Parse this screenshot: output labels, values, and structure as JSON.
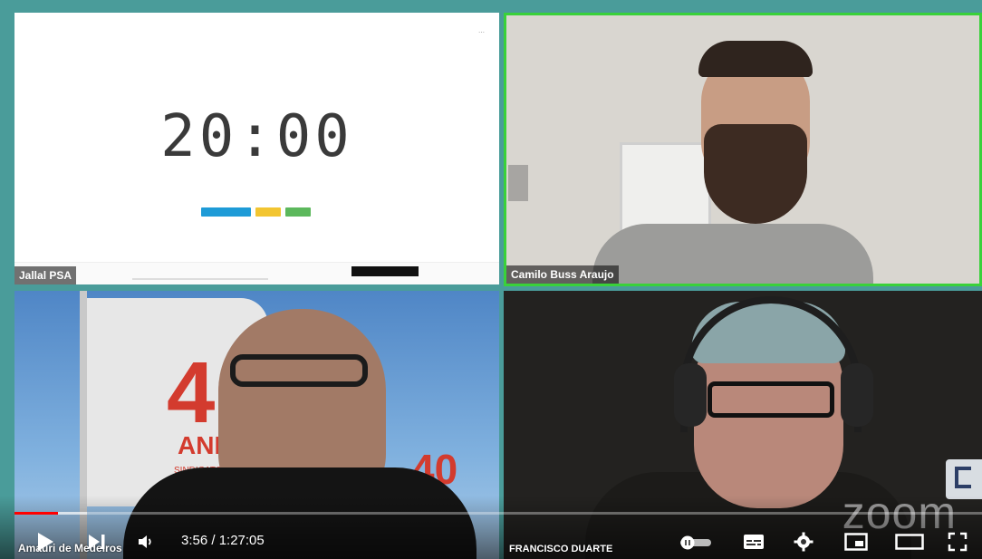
{
  "participants": [
    {
      "name": "Jallal PSA"
    },
    {
      "name": "Camilo Buss Araujo"
    },
    {
      "name": "Amauri de Medeiros"
    },
    {
      "name": "FRANCISCO DUARTE"
    }
  ],
  "shared_screen": {
    "timer": "20:00"
  },
  "flag": {
    "number": "40",
    "acronym": "AND",
    "subtitle": "SINDICATO"
  },
  "watermark": "zoom",
  "player": {
    "current_time": "3:56",
    "duration": "1:27:05",
    "time_display": "3:56 / 1:27:05",
    "progress_fraction": 0.045,
    "buffered_fraction": 0.075,
    "icons": [
      "play-icon",
      "next-icon",
      "volume-icon",
      "autoplay-toggle-icon",
      "subtitles-icon",
      "settings-icon",
      "miniplayer-icon",
      "theater-icon",
      "fullscreen-icon"
    ],
    "accent": "#ff0000"
  },
  "colors": {
    "background": "#4a9c9a",
    "active_speaker_border": "#3ad13a"
  }
}
